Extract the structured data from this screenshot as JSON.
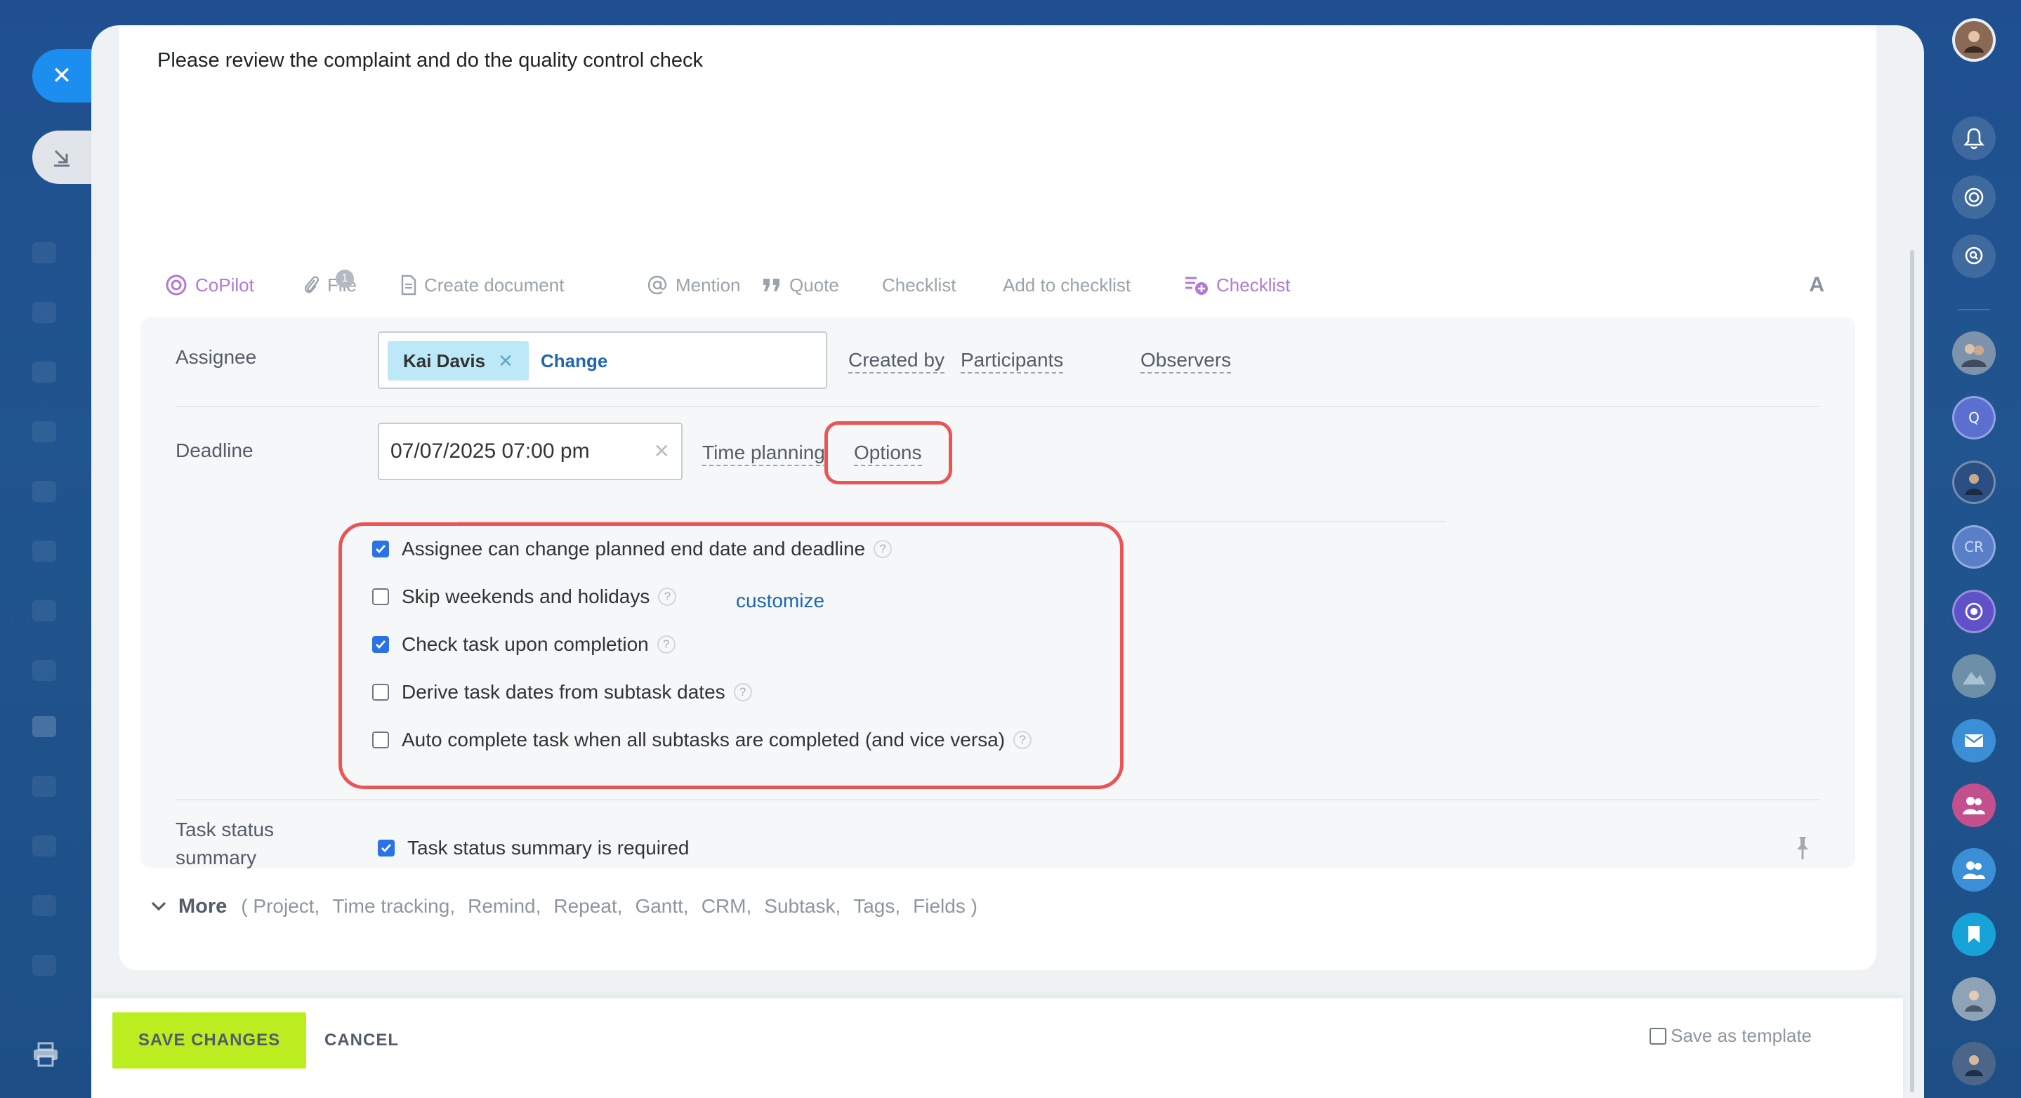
{
  "description": "Please review the complaint and do the quality control check",
  "toolbar": {
    "copilot": "CoPilot",
    "file": "File",
    "file_count": "1",
    "create_document": "Create document",
    "mention": "Mention",
    "quote": "Quote",
    "checklist_text": "Checklist",
    "add_to_checklist": "Add to checklist",
    "checklist": "Checklist",
    "font": "A"
  },
  "assignee": {
    "label": "Assignee",
    "name": "Kai Davis",
    "change": "Change",
    "links": [
      "Created by",
      "Participants",
      "Observers"
    ]
  },
  "deadline": {
    "label": "Deadline",
    "value": "07/07/2025 07:00 pm",
    "time_planning": "Time planning",
    "options": "Options"
  },
  "options": [
    {
      "label": "Assignee can change planned end date and deadline",
      "checked": true
    },
    {
      "label": "Skip weekends and holidays",
      "checked": false
    },
    {
      "label": "Check task upon completion",
      "checked": true
    },
    {
      "label": "Derive task dates from subtask dates",
      "checked": false
    },
    {
      "label": "Auto complete task when all subtasks are completed (and vice versa)",
      "checked": false
    }
  ],
  "customize": "customize",
  "status_summary": {
    "label_line1": "Task status",
    "label_line2": "summary",
    "checkbox_label": "Task status summary is required",
    "checked": true
  },
  "more": {
    "title": "More",
    "items": [
      "( Project,",
      "Time tracking,",
      "Remind,",
      "Repeat,",
      "Gantt,",
      "CRM,",
      "Subtask,",
      "Tags,",
      "Fields )"
    ]
  },
  "footer": {
    "save": "SAVE CHANGES",
    "cancel": "CANCEL",
    "save_as_template": "Save as template"
  },
  "sidebar_right": {
    "avatar_q": "Q",
    "avatar_cr": "CR"
  },
  "colors": {
    "accent_blue": "#2067b0",
    "checkbox_blue": "#2a72e5",
    "save_green": "#bbed21",
    "highlight_red": "#ea5455",
    "copilot_purple": "#b07ad6"
  }
}
